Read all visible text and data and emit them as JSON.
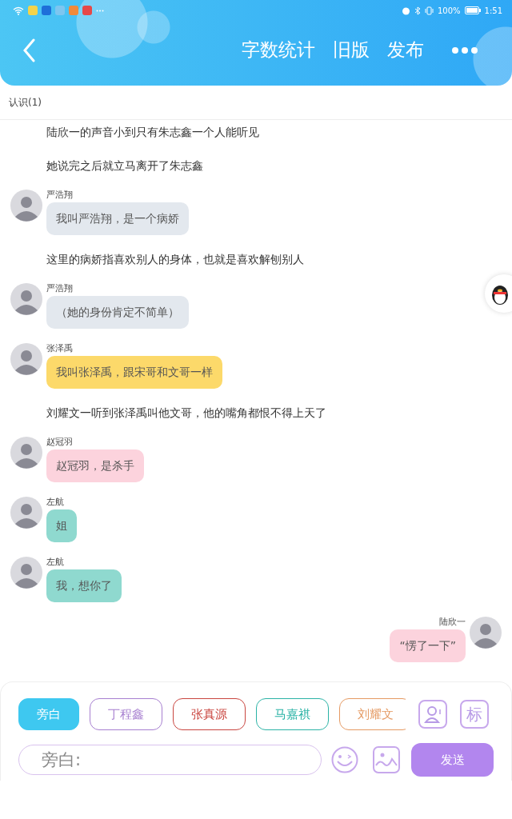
{
  "status_bar": {
    "battery_text": "100%",
    "time": "1:51"
  },
  "header": {
    "actions": [
      "字数统计",
      "旧版",
      "发布"
    ]
  },
  "subheader": {
    "title": "认识(1)"
  },
  "messages": [
    {
      "kind": "narration",
      "text": "陆欣一的声音小到只有朱志鑫一个人能听见"
    },
    {
      "kind": "narration",
      "text": "她说完之后就立马离开了朱志鑫"
    },
    {
      "kind": "bubble",
      "outgoing": false,
      "name": "严浩翔",
      "text": "我叫严浩翔，是一个病娇",
      "color": "#e3e8ee"
    },
    {
      "kind": "narration",
      "text": "这里的病娇指喜欢别人的身体，也就是喜欢解刨别人"
    },
    {
      "kind": "bubble",
      "outgoing": false,
      "name": "严浩翔",
      "text": "（她的身份肯定不简单）",
      "color": "#e3e8ee"
    },
    {
      "kind": "bubble",
      "outgoing": false,
      "name": "张泽禹",
      "text": "我叫张泽禹，跟宋哥和文哥一样",
      "color": "#fcd96a"
    },
    {
      "kind": "narration",
      "text": "刘耀文一听到张泽禹叫他文哥，他的嘴角都恨不得上天了"
    },
    {
      "kind": "bubble",
      "outgoing": false,
      "name": "赵冠羽",
      "text": "赵冠羽，是杀手",
      "color": "#fcd3dd"
    },
    {
      "kind": "bubble",
      "outgoing": false,
      "name": "左航",
      "text": "姐",
      "color": "#8fd9cf"
    },
    {
      "kind": "bubble",
      "outgoing": false,
      "name": "左航",
      "text": "我，想你了",
      "color": "#8fd9cf"
    },
    {
      "kind": "bubble",
      "outgoing": true,
      "name": "陆欣一",
      "text": "“愣了一下”",
      "color": "#fcd3dd"
    }
  ],
  "composer": {
    "characters": [
      {
        "label": "旁白",
        "selected": true,
        "color": "#3ec8f0"
      },
      {
        "label": "丁程鑫",
        "selected": false,
        "color": "#a77fd0"
      },
      {
        "label": "张真源",
        "selected": false,
        "color": "#c9453f"
      },
      {
        "label": "马嘉祺",
        "selected": false,
        "color": "#2bb3a6"
      },
      {
        "label": "刘耀文",
        "selected": false,
        "color": "#e59a63"
      }
    ],
    "tag_button": "标",
    "input": {
      "placeholder": "旁白:"
    },
    "send": "发送"
  }
}
